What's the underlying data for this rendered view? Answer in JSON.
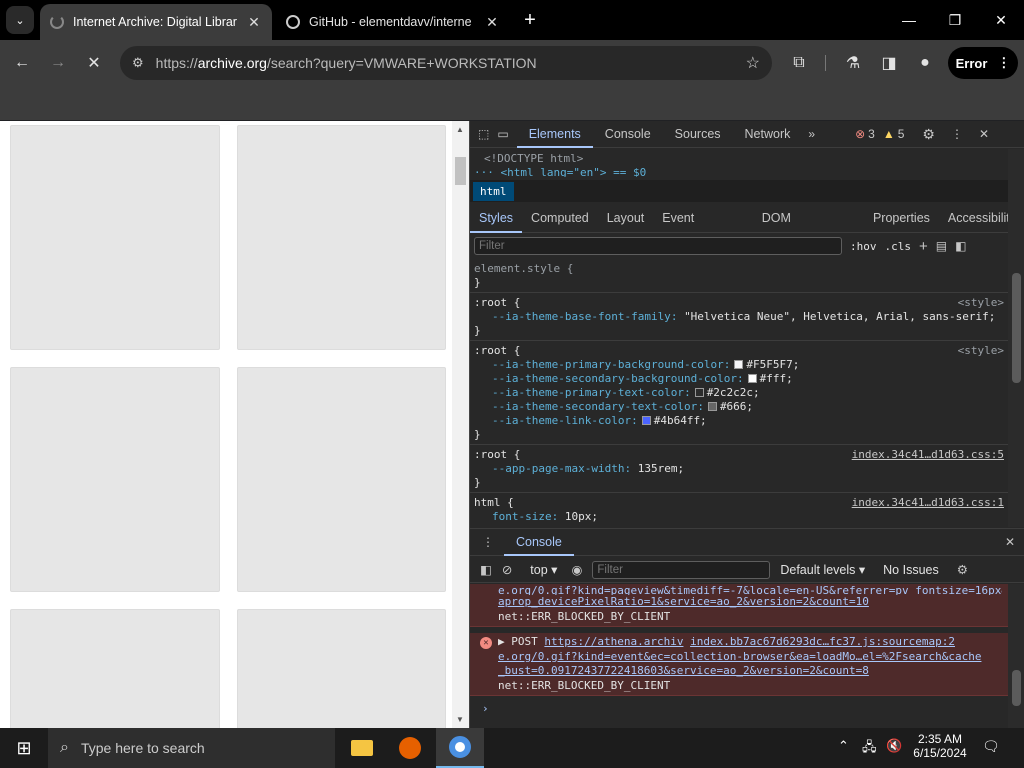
{
  "tabs": [
    {
      "title": "Internet Archive: Digital Librar",
      "active": true
    },
    {
      "title": "GitHub - elementdavv/interne",
      "active": false
    }
  ],
  "toolbar": {
    "url_prefix": "https://",
    "url_domain": "archive.org",
    "url_path": "/search?query=VMWARE+WORKSTATION",
    "error_label": "Error"
  },
  "devtools": {
    "tabs": [
      "Elements",
      "Console",
      "Sources",
      "Network"
    ],
    "errors_count": "3",
    "warnings_count": "5",
    "dom_lines": [
      "<!DOCTYPE html>",
      "<html lang=\"en\"> == $0"
    ],
    "breadcrumb": "html",
    "styles_tabs": [
      "Styles",
      "Computed",
      "Layout",
      "Event Listeners",
      "DOM Breakpoints",
      "Properties",
      "Accessibility"
    ],
    "filter_placeholder": "Filter",
    "hov": ":hov",
    "cls": ".cls",
    "rules": {
      "r0_sel": "element.style {",
      "close": "}",
      "r1_sel": ":root {",
      "r1_src": "<style>",
      "r1_p": "--ia-theme-base-font-family",
      "r1_v": "\"Helvetica Neue\", Helvetica, Arial, sans-serif;",
      "r2_sel": ":root {",
      "r2_src": "<style>",
      "r2_props": [
        {
          "p": "--ia-theme-primary-background-color",
          "v": "#F5F5F7;",
          "c": "#F5F5F7"
        },
        {
          "p": "--ia-theme-secondary-background-color",
          "v": "#fff;",
          "c": "#ffffff"
        },
        {
          "p": "--ia-theme-primary-text-color",
          "v": "#2c2c2c;",
          "c": "#2c2c2c"
        },
        {
          "p": "--ia-theme-secondary-text-color",
          "v": "#666;",
          "c": "#666666"
        },
        {
          "p": "--ia-theme-link-color",
          "v": "#4b64ff;",
          "c": "#4b64ff"
        }
      ],
      "r3_sel": ":root {",
      "r3_src": "index.34c41…d1d63.css:5",
      "r3_p": "--app-page-max-width",
      "r3_v": "135rem;",
      "r4_sel": "html {",
      "r4_src": "index.34c41…d1d63.css:1",
      "r4_p": "font-size",
      "r4_v": "10px;"
    },
    "console": {
      "title": "Console",
      "context": "top",
      "filter_placeholder": "Filter",
      "levels": "Default levels",
      "issues": "No Issues",
      "msg1_a": "e.org/0.gif?kind=pageview&timediff=-7&locale=en-US&referrer=pv_fontsize=16px&i",
      "msg1_b": "aprop_devicePixelRatio=1&service=ao_2&version=2&count=10",
      "msg1_err": "net::ERR_BLOCKED_BY_CLIENT",
      "msg2_method": "POST",
      "msg2_url1": "https://athena.archiv",
      "msg2_src": "index.bb7ac67d6293dc…fc37.js:sourcemap:2",
      "msg2_l2": "e.org/0.gif?kind=event&ec=collection-browser&ea=loadMo…el=%2Fsearch&cache",
      "msg2_l3": "_bust=0.09172437722418603&service=ao_2&version=2&count=8",
      "msg2_err": "net::ERR_BLOCKED_BY_CLIENT",
      "prompt": "›"
    }
  },
  "taskbar": {
    "search_placeholder": "Type here to search",
    "time": "2:35 AM",
    "date": "6/15/2024"
  }
}
